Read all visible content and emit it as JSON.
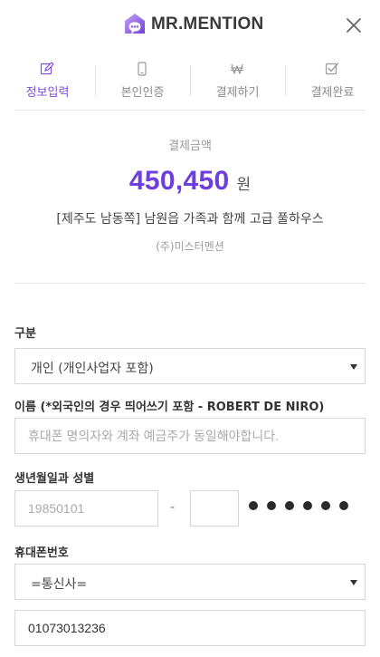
{
  "header": {
    "logo_text": "MR.MENTION",
    "icons": {
      "logo": "mr-mention-logo-mark",
      "close": "close-icon"
    }
  },
  "steps": [
    {
      "label": "정보입력",
      "icon": "edit-icon",
      "active": true
    },
    {
      "label": "본인인증",
      "icon": "phone-icon",
      "active": false
    },
    {
      "label": "결제하기",
      "icon": "won-icon",
      "active": false
    },
    {
      "label": "결제완료",
      "icon": "checkbox-icon",
      "active": false
    }
  ],
  "summary": {
    "amount_label": "결제금액",
    "amount": "450,450",
    "amount_unit": "원",
    "product_name": "[제주도 남동쪽] 남원읍 가족과 함께 고급 풀하우스",
    "company": "(주)미스터멘션"
  },
  "form": {
    "type_label": "구분",
    "type_value": "개인 (개인사업자 포함)",
    "name_label": "이름 (*외국인의 경우 띄어쓰기 포함 - ROBERT DE NIRO)",
    "name_placeholder": "휴대폰 명의자와 계좌 예금주가 동일해야합니다.",
    "name_value": "",
    "birth_label": "생년월일과 성별",
    "birth_placeholder": "19850101",
    "birth_value": "",
    "birth_separator": "-",
    "gender_value": "",
    "phone_label": "휴대폰번호",
    "carrier_value": "=통신사=",
    "phone_value": "01073013236"
  },
  "colors": {
    "accent": "#6c3ee0",
    "active_step": "#7b4fd6",
    "logo_gradient": [
      "#b58cf0",
      "#6f3fd9"
    ]
  }
}
